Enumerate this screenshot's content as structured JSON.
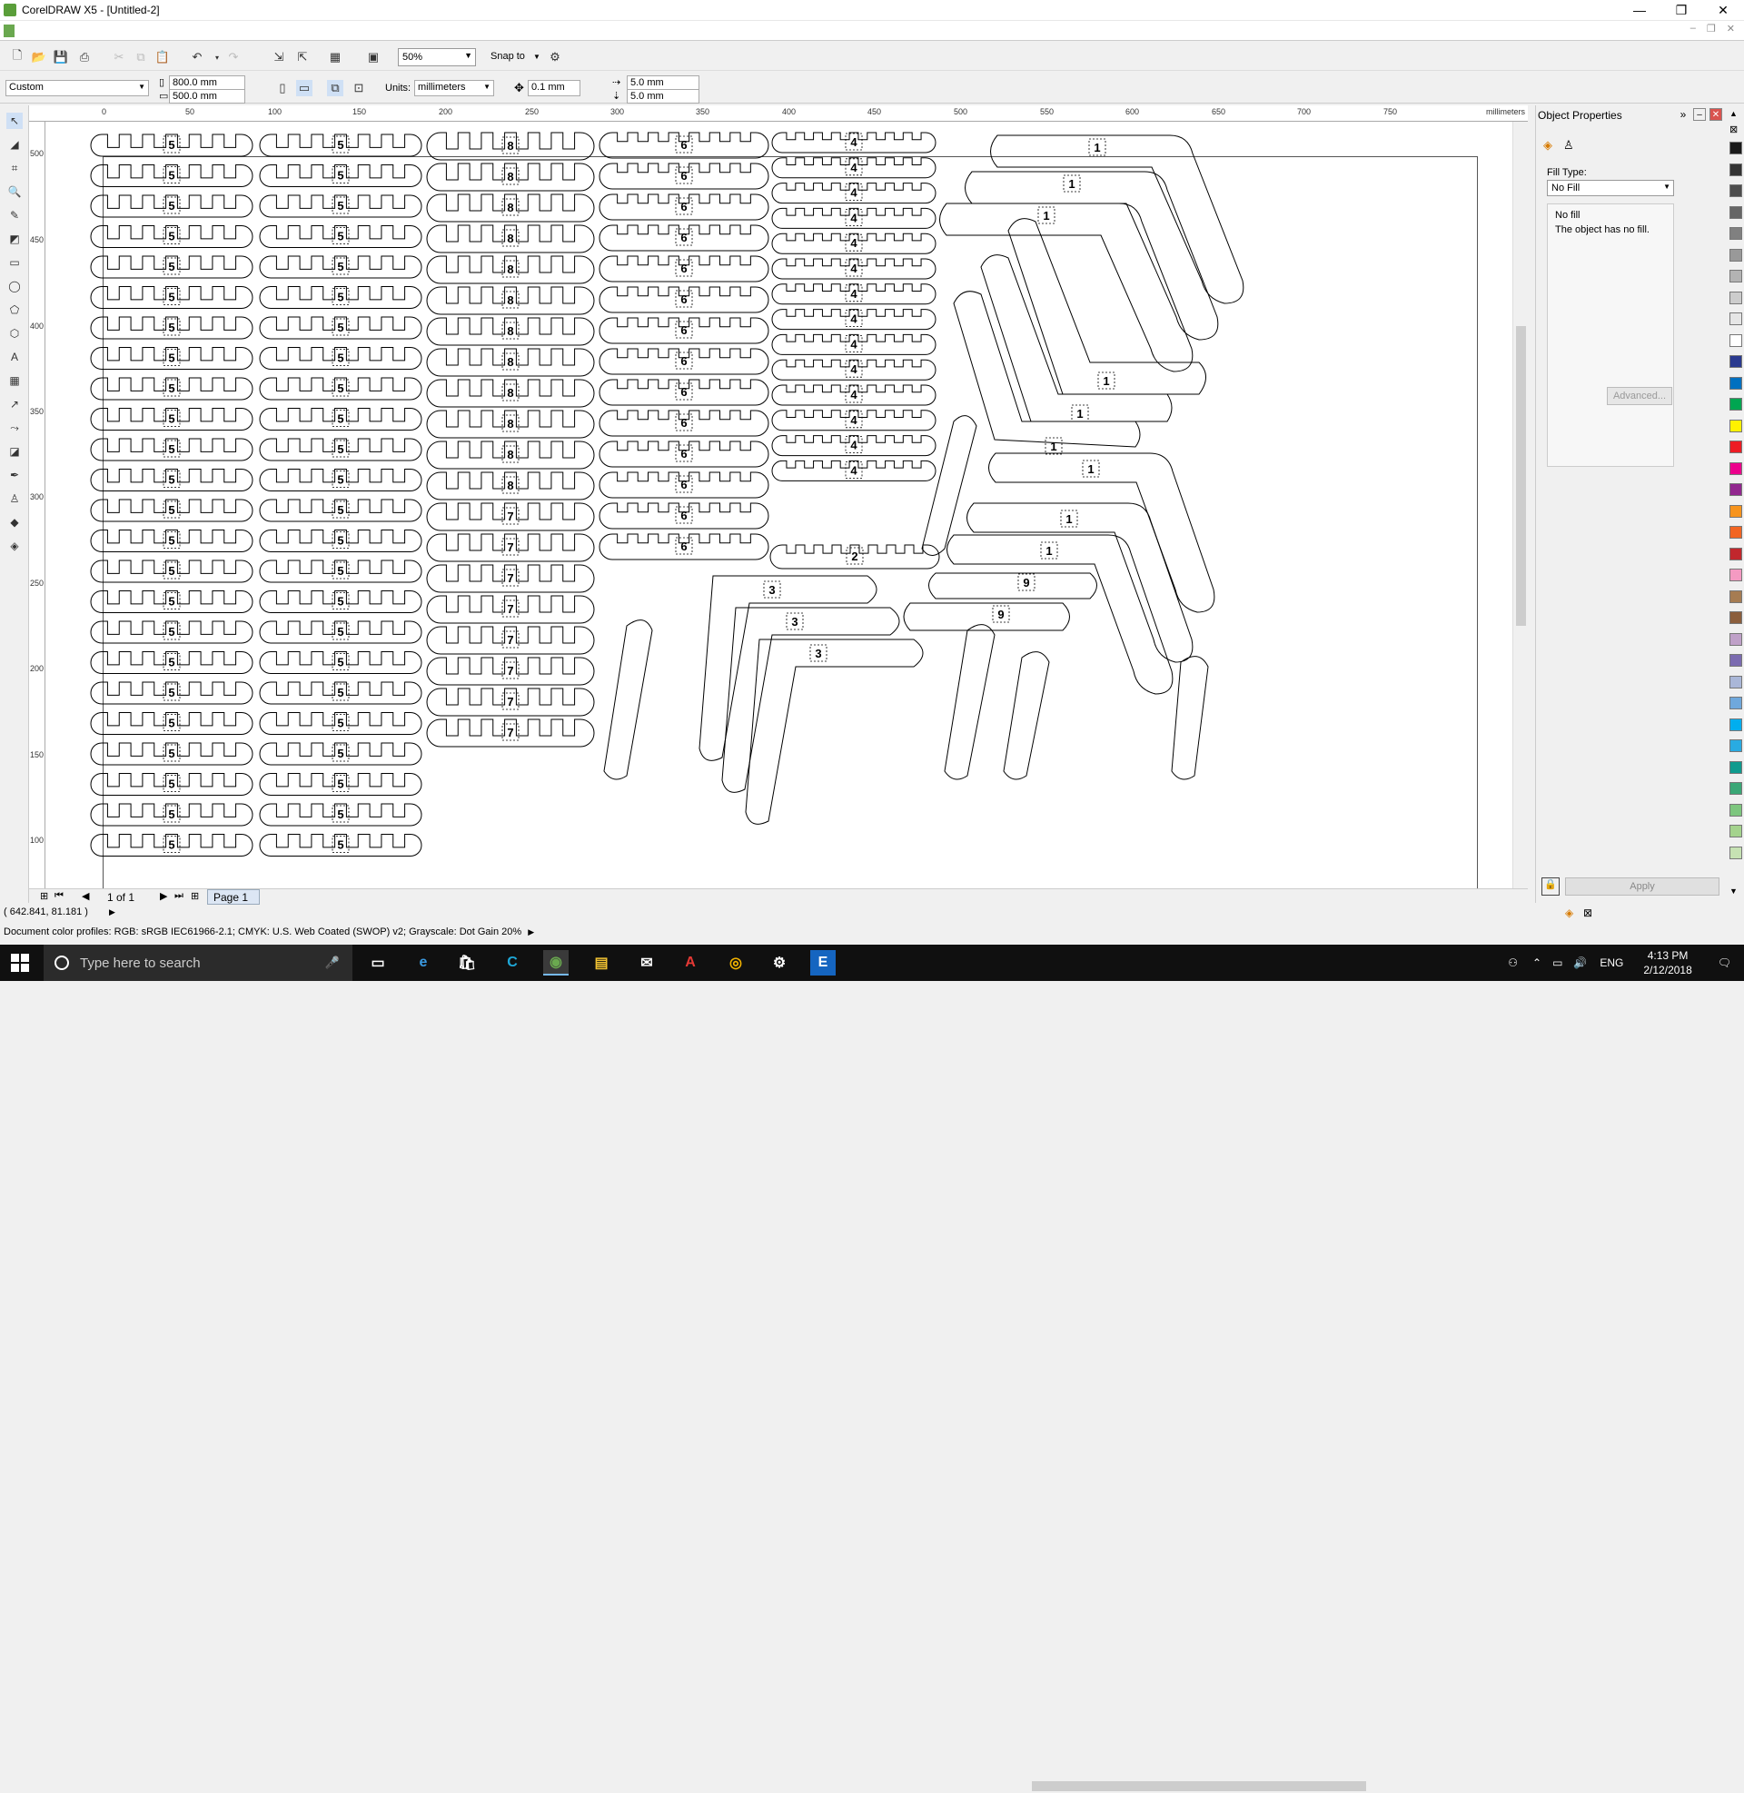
{
  "window": {
    "title": "CorelDRAW X5 - [Untitled-2]",
    "minimize": "—",
    "restore": "❐",
    "close": "✕"
  },
  "toolbar": {
    "zoom_value": "50%",
    "snap_to": "Snap to"
  },
  "property_bar": {
    "page_preset": "Custom",
    "width": "800.0 mm",
    "height": "500.0 mm",
    "units_label": "Units:",
    "units_value": "millimeters",
    "nudge": "0.1 mm",
    "dup_x": "5.0 mm",
    "dup_y": "5.0 mm"
  },
  "ruler": {
    "unit_label": "millimeters",
    "top_ticks": [
      "0",
      "50",
      "100",
      "150",
      "200",
      "250",
      "300",
      "350",
      "400",
      "450",
      "500",
      "550",
      "600",
      "650",
      "700",
      "750"
    ],
    "left_ticks": [
      "500",
      "450",
      "400",
      "350",
      "300",
      "250",
      "200",
      "150",
      "100"
    ]
  },
  "page_nav": {
    "position": "1 of 1",
    "page_tab": "Page 1"
  },
  "status": {
    "coords": "( 642.841, 81.181 )",
    "color_profiles": "Document color profiles: RGB: sRGB IEC61966-2.1; CMYK: U.S. Web Coated (SWOP) v2; Grayscale: Dot Gain 20%"
  },
  "docker": {
    "title": "Object Properties",
    "fill_type_label": "Fill Type:",
    "fill_type_value": "No Fill",
    "no_fill_title": "No fill",
    "no_fill_desc": "The object has no fill.",
    "advanced": "Advanced...",
    "apply": "Apply"
  },
  "drawing": {
    "col1_label": "5",
    "col2_label": "5",
    "col3_label_top": "8",
    "col3_label_bottom": "7",
    "col4_label": "6",
    "col5_label": "4",
    "l_label": "1",
    "c_label": "2",
    "b_label": "3",
    "r_label": "9"
  },
  "taskbar": {
    "search_placeholder": "Type here to search",
    "language": "ENG",
    "time": "4:13 PM",
    "date": "2/12/2018"
  },
  "palette_colors": [
    "#1a1a1a",
    "#333333",
    "#4d4d4d",
    "#666666",
    "#808080",
    "#999999",
    "#b3b3b3",
    "#cccccc",
    "#e6e6e6",
    "#ffffff",
    "#2a3a8f",
    "#0070c0",
    "#00a651",
    "#fff200",
    "#ed1c24",
    "#ec008c",
    "#92278f",
    "#f7941d",
    "#f26522",
    "#c1272d",
    "#f49ac2",
    "#a67c52",
    "#8b5e3c",
    "#bfa0c8",
    "#7b6bb0",
    "#aab7d8",
    "#6fa8dc",
    "#00aeef",
    "#29abe2",
    "#0f9b8e",
    "#3aa776",
    "#7dc67e",
    "#a4d38d",
    "#c6e2b3"
  ]
}
